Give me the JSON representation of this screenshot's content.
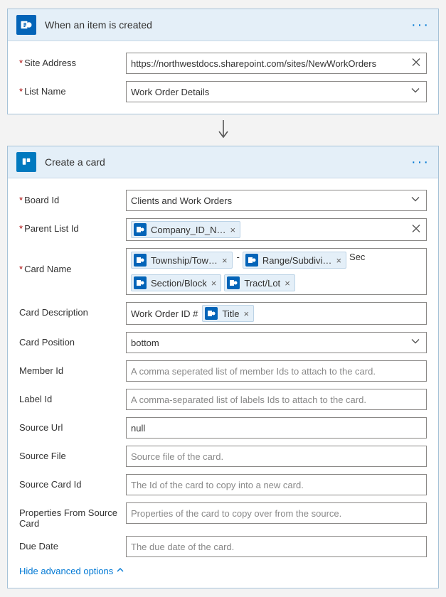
{
  "trigger": {
    "title": "When an item is created",
    "fields": {
      "site_address": {
        "label": "Site Address",
        "required": true,
        "value": "https://northwestdocs.sharepoint.com/sites/NewWorkOrders"
      },
      "list_name": {
        "label": "List Name",
        "required": true,
        "value": "Work Order Details"
      }
    }
  },
  "action": {
    "title": "Create a card",
    "fields": {
      "board_id": {
        "label": "Board Id",
        "required": true,
        "value": "Clients and Work Orders"
      },
      "parent_list": {
        "label": "Parent List Id",
        "required": true,
        "tokens": [
          {
            "label": "Company_ID_N…"
          }
        ]
      },
      "card_name": {
        "label": "Card Name",
        "required": true,
        "tokens_row1": [
          {
            "label": "Township/Tow…"
          },
          {
            "label": "Range/Subdivi…"
          }
        ],
        "trailing1": "Sec",
        "tokens_row2": [
          {
            "label": "Section/Block"
          },
          {
            "label": "Tract/Lot"
          }
        ]
      },
      "card_desc": {
        "label": "Card Description",
        "prefix": "Work Order ID #",
        "tokens": [
          {
            "label": "Title"
          }
        ]
      },
      "card_position": {
        "label": "Card Position",
        "value": "bottom"
      },
      "member_id": {
        "label": "Member Id",
        "placeholder": "A comma seperated list of member Ids to attach to the card."
      },
      "label_id": {
        "label": "Label Id",
        "placeholder": "A comma-separated list of labels Ids to attach to the card."
      },
      "source_url": {
        "label": "Source Url",
        "value": "null"
      },
      "source_file": {
        "label": "Source File",
        "placeholder": "Source file of the card."
      },
      "source_card": {
        "label": "Source Card Id",
        "placeholder": "The Id of the card to copy into a new card."
      },
      "props_from": {
        "label": "Properties From Source Card",
        "placeholder": "Properties of the card to copy over from the source."
      },
      "due_date": {
        "label": "Due Date",
        "placeholder": "The due date of the card."
      }
    },
    "hide_advanced": "Hide advanced options"
  }
}
